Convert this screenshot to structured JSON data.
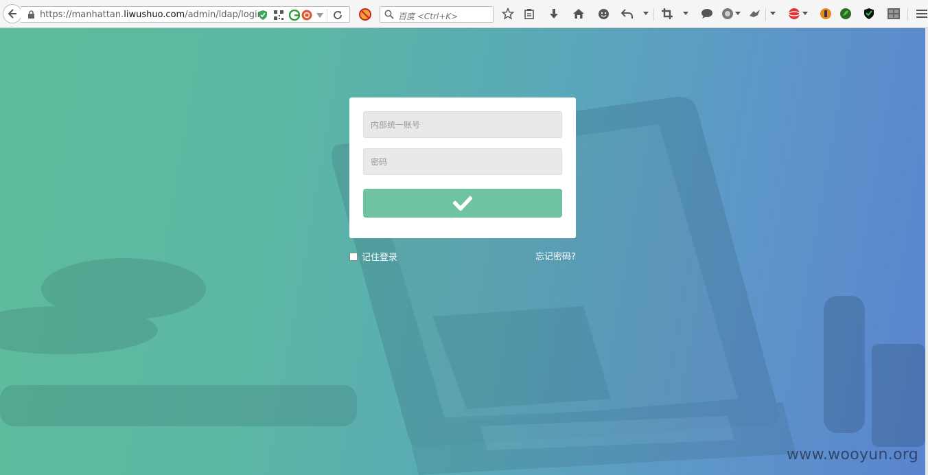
{
  "browser": {
    "url_prefix": "https://manhattan.",
    "url_host": "liwushuo.com",
    "url_path": "/admin/ldap/login",
    "search_placeholder": "百度 <Ctrl+K>"
  },
  "login": {
    "username_placeholder": "内部统一账号",
    "password_placeholder": "密码",
    "remember_label": "记住登录",
    "forgot_label": "忘记密码?"
  },
  "watermark": "www.wooyun.org",
  "colors": {
    "gradient_start": "#5ebc9b",
    "gradient_end": "#5a84cf",
    "submit_button": "#6dc3a2",
    "card": "#ffffff"
  },
  "icons": {
    "back": "back-arrow-icon",
    "lock": "lock-icon",
    "reload": "reload-icon",
    "search": "search-icon",
    "bookmark_star": "star-icon",
    "reading_list": "clipboard-icon",
    "downloads": "download-icon",
    "home": "home-icon",
    "submit": "checkmark-icon",
    "menu": "hamburger-menu-icon"
  }
}
